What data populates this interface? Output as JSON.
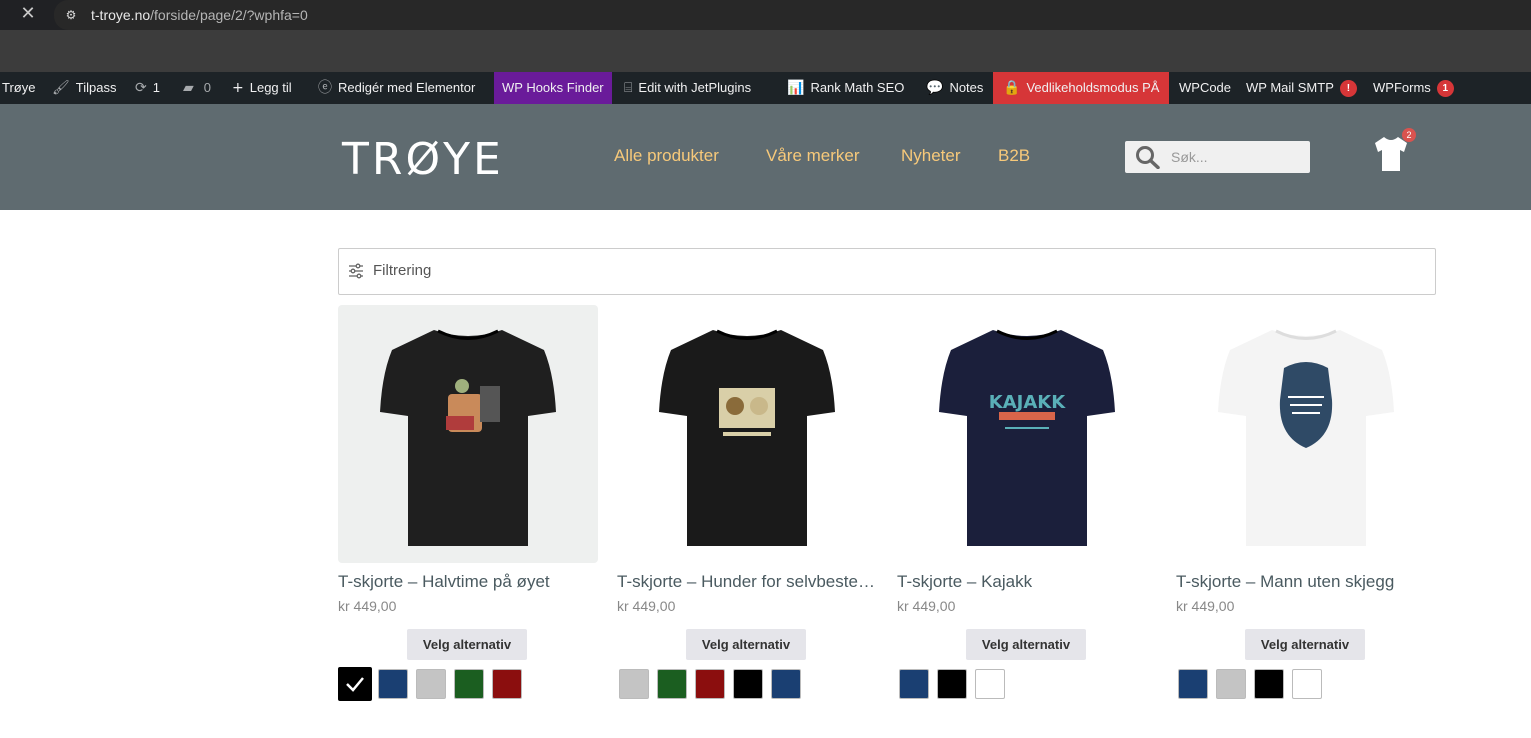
{
  "browser": {
    "close_glyph": "✕",
    "site_info_glyph": "⚙",
    "url_host": "t-troye.no",
    "url_path": "/forside/page/2/?wphfa=0"
  },
  "adminbar": {
    "site_label": "Trøye",
    "customize_label": "Tilpass",
    "updates_count": "1",
    "comments_count": "0",
    "new_label": "Legg til",
    "elementor_label": "Redigér med Elementor",
    "hooks_finder_label": "WP Hooks Finder",
    "jetplugins_label": "Edit with JetPlugins",
    "rankmath_label": "Rank Math SEO",
    "notes_label": "Notes",
    "maintenance_label": "Vedlikeholdsmodus PÅ",
    "wpcode_label": "WPCode",
    "wpmail_label": "WP Mail SMTP",
    "wpmail_badge": "!",
    "wpforms_label": "WPForms",
    "wpforms_badge": "1"
  },
  "header": {
    "logo_text": "TRØYE",
    "nav": [
      "Alle produkter",
      "Våre merker",
      "Nyheter",
      "B2B"
    ],
    "search_placeholder": "Søk...",
    "cart_count": "2"
  },
  "filter": {
    "label": "Filtrering"
  },
  "products": [
    {
      "title": "T-skjorte – Halvtime på øyet",
      "price": "kr 449,00",
      "button": "Velg alternativ",
      "shirt_color": "#1f1f1f",
      "print": "halvtime",
      "swatches": [
        "#000000",
        "#1a3f72",
        "#c4c4c4",
        "#1b5e20",
        "#8b0e0e"
      ],
      "selected": 0
    },
    {
      "title": "T-skjorte – Hunder for selvbestemt avfall",
      "price": "kr 449,00",
      "button": "Velg alternativ",
      "shirt_color": "#1a1a1a",
      "print": "hunder",
      "swatches": [
        "#c4c4c4",
        "#1b5e20",
        "#8b0e0e",
        "#000000",
        "#1a3f72"
      ],
      "selected": -1
    },
    {
      "title": "T-skjorte – Kajakk",
      "price": "kr 449,00",
      "button": "Velg alternativ",
      "shirt_color": "#1b1f3b",
      "print": "kajakk",
      "print_text": "KAJAKK",
      "swatches": [
        "#1a3f72",
        "#000000",
        "#ffffff"
      ],
      "selected": -1
    },
    {
      "title": "T-skjorte – Mann uten skjegg",
      "price": "kr 449,00",
      "button": "Velg alternativ",
      "shirt_color": "#f4f4f4",
      "print": "skjegg",
      "swatches": [
        "#1a3f72",
        "#c4c4c4",
        "#000000",
        "#ffffff"
      ],
      "selected": -1
    }
  ]
}
